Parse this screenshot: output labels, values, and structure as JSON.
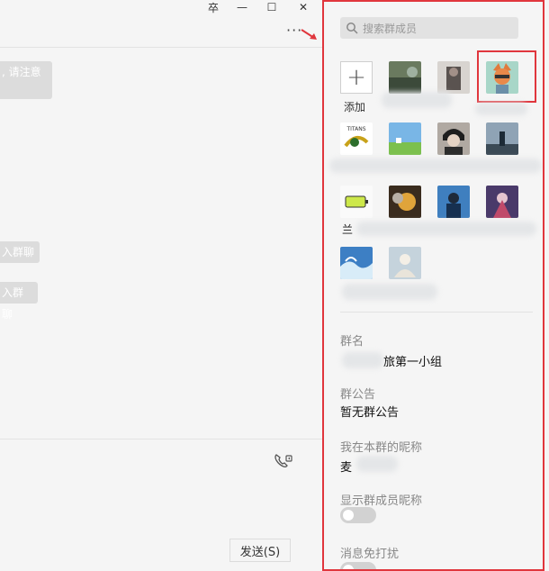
{
  "window": {
    "pin_icon": "pin-icon",
    "min_icon": "minimize-icon",
    "max_icon": "maximize-icon",
    "close_icon": "close-icon",
    "pin_glyph": "卒",
    "min_glyph": "—",
    "max_glyph": "☐",
    "close_glyph": "✕"
  },
  "chat": {
    "more_glyph": "···",
    "bubbles": [
      ", 请注意",
      "入群聊",
      "入群聊"
    ],
    "send_label": "发送(S)",
    "accent": "#e0363d"
  },
  "panel": {
    "search_placeholder": "搜索群成员",
    "add_symbol": "+",
    "add_label": "添加",
    "group_name_label": "群名",
    "group_name_value": "旅第一小组",
    "announcement_label": "群公告",
    "announcement_value": "暂无群公告",
    "nickname_label": "我在本群的昵称",
    "nickname_value": "麦",
    "show_nickname_label": "显示群成员昵称",
    "show_nickname_on": false,
    "mute_label": "消息免打扰",
    "mute_on": false,
    "member_3_1_label": "兰"
  }
}
